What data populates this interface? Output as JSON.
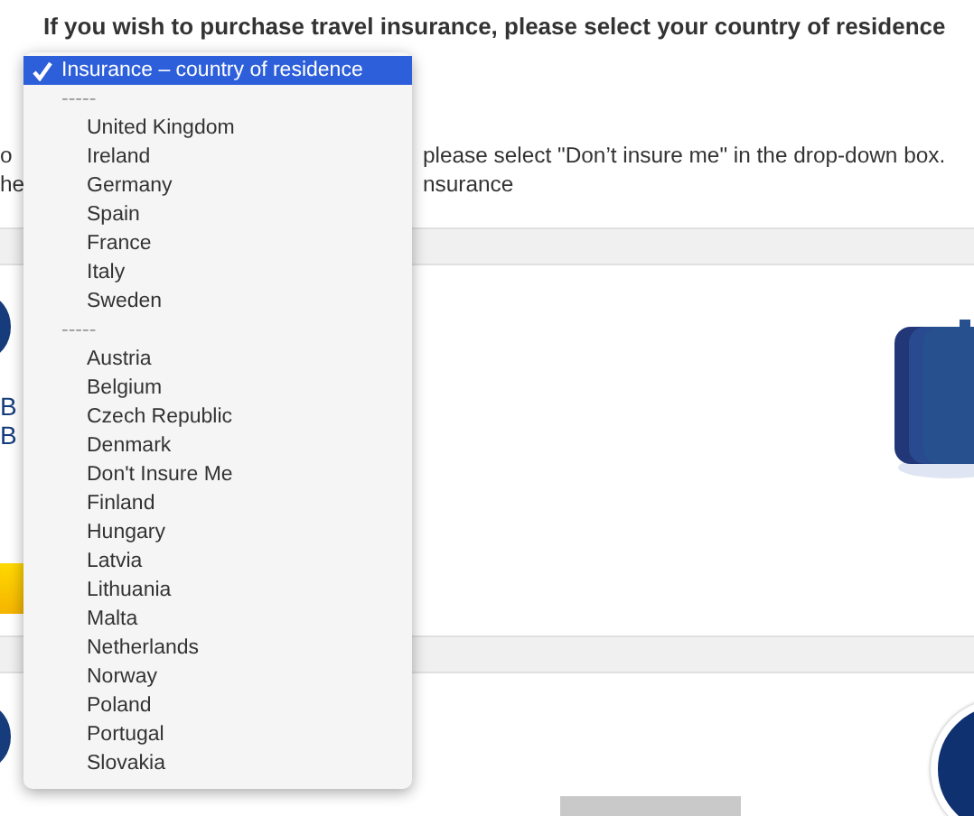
{
  "heading": "If you wish to purchase travel insurance, please select your country of residence",
  "notice_lines": [
    {
      "left": "o",
      "right": "please select \"Don’t insure me\" in the drop-down box."
    },
    {
      "left": "he",
      "right": "nsurance"
    }
  ],
  "card_texts": [
    "B",
    "B"
  ],
  "dropdown": {
    "items": [
      {
        "kind": "option",
        "label": "Insurance – country of residence",
        "selected": true
      },
      {
        "kind": "separator",
        "label": "-----",
        "selected": false
      },
      {
        "kind": "option",
        "label": "United Kingdom",
        "selected": false
      },
      {
        "kind": "option",
        "label": "Ireland",
        "selected": false
      },
      {
        "kind": "option",
        "label": "Germany",
        "selected": false
      },
      {
        "kind": "option",
        "label": "Spain",
        "selected": false
      },
      {
        "kind": "option",
        "label": "France",
        "selected": false
      },
      {
        "kind": "option",
        "label": "Italy",
        "selected": false
      },
      {
        "kind": "option",
        "label": "Sweden",
        "selected": false
      },
      {
        "kind": "separator",
        "label": "-----",
        "selected": false
      },
      {
        "kind": "option",
        "label": "Austria",
        "selected": false
      },
      {
        "kind": "option",
        "label": "Belgium",
        "selected": false
      },
      {
        "kind": "option",
        "label": "Czech Republic",
        "selected": false
      },
      {
        "kind": "option",
        "label": "Denmark",
        "selected": false
      },
      {
        "kind": "option",
        "label": "Don't Insure Me",
        "selected": false
      },
      {
        "kind": "option",
        "label": "Finland",
        "selected": false
      },
      {
        "kind": "option",
        "label": "Hungary",
        "selected": false
      },
      {
        "kind": "option",
        "label": "Latvia",
        "selected": false
      },
      {
        "kind": "option",
        "label": "Lithuania",
        "selected": false
      },
      {
        "kind": "option",
        "label": "Malta",
        "selected": false
      },
      {
        "kind": "option",
        "label": "Netherlands",
        "selected": false
      },
      {
        "kind": "option",
        "label": "Norway",
        "selected": false
      },
      {
        "kind": "option",
        "label": "Poland",
        "selected": false
      },
      {
        "kind": "option",
        "label": "Portugal",
        "selected": false
      },
      {
        "kind": "option",
        "label": "Slovakia",
        "selected": false
      }
    ]
  }
}
